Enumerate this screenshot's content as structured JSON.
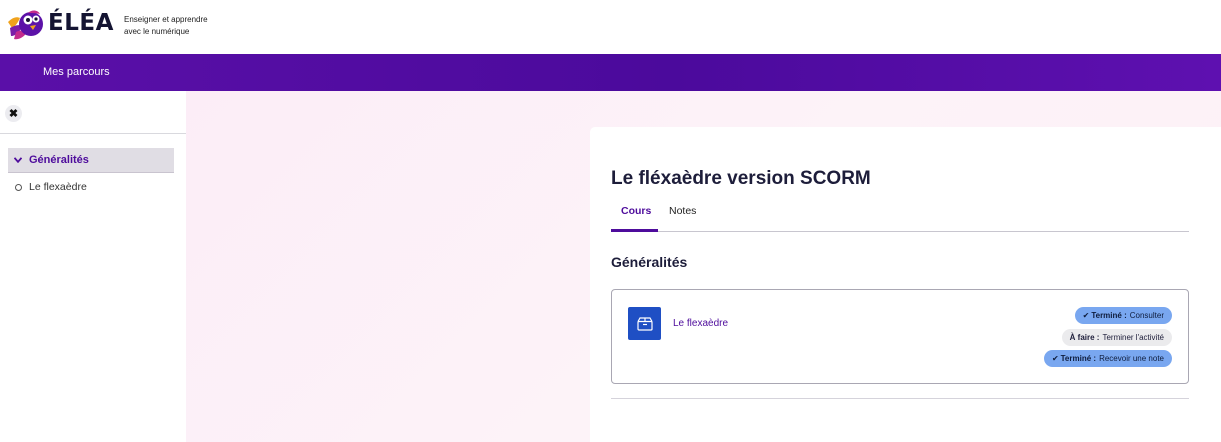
{
  "brand": {
    "name": "ÉLÉA",
    "tagline": "Enseigner et apprendre avec le numérique",
    "colors": {
      "primary": "#4e0c9c",
      "navbar": "#5a0fa8",
      "icon_blue": "#1f4fc4",
      "badge_done": "#79a7f0"
    }
  },
  "navbar": {
    "link": "Mes parcours"
  },
  "drawer": {
    "close_icon": "close-icon",
    "section": {
      "label": "Généralités",
      "icon": "chevron-down-icon"
    },
    "items": [
      {
        "label": "Le flexaèdre",
        "icon": "circle-icon"
      }
    ]
  },
  "course": {
    "title": "Le fléxaèdre version SCORM",
    "tabs": [
      {
        "label": "Cours",
        "active": true
      },
      {
        "label": "Notes",
        "active": false
      }
    ],
    "section_heading": "Généralités",
    "activity": {
      "icon": "package-icon",
      "name": "Le flexaèdre",
      "badges": [
        {
          "status": "Terminé :",
          "text": "Consulter",
          "done": true
        },
        {
          "status": "À faire :",
          "text": "Terminer l'activité",
          "done": false
        },
        {
          "status": "Terminé :",
          "text": "Recevoir une note",
          "done": true
        }
      ]
    }
  }
}
